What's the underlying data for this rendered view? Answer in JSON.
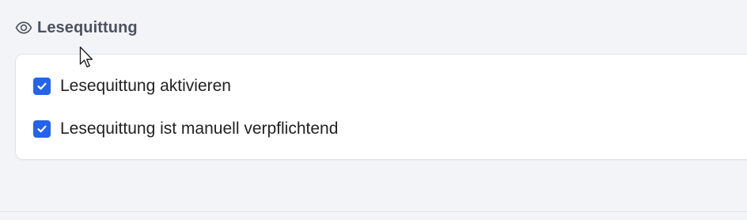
{
  "section": {
    "title": "Lesequittung",
    "icon": "eye-icon"
  },
  "options": [
    {
      "label": "Lesequittung aktivieren",
      "checked": true
    },
    {
      "label": "Lesequittung ist manuell verpflichtend",
      "checked": true
    }
  ],
  "colors": {
    "accent": "#2563eb",
    "background": "#f3f4f7",
    "card": "#ffffff",
    "title": "#4b5160"
  }
}
